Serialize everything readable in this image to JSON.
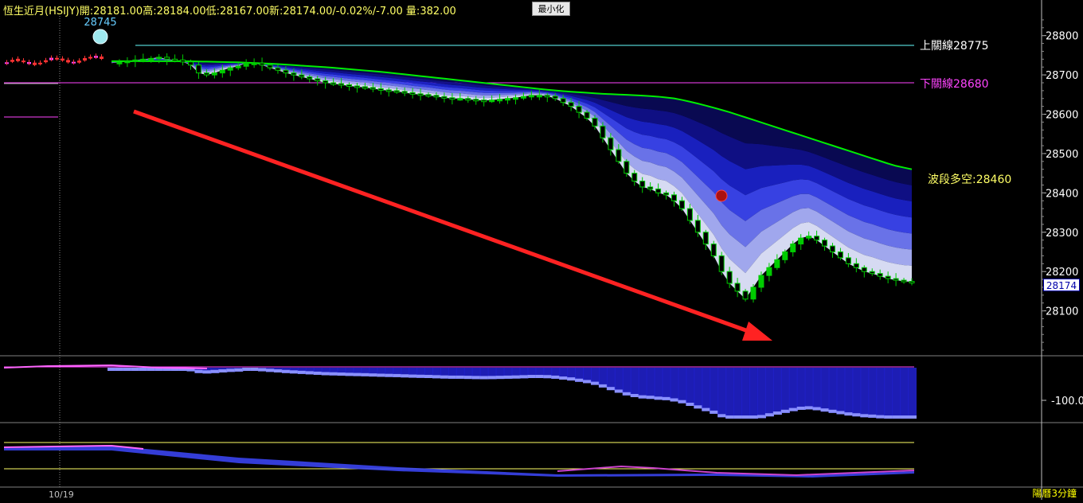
{
  "header": {
    "text": "恆生近月(HSIJY)開:28181.00高:28184.00低:28167.00新:28174.00/-0.02%/-7.00 量:382.00",
    "minimize_label": "最小化"
  },
  "labels": {
    "upper_line": "上關線28775",
    "lower_line": "下關線28680",
    "wave": "波段多空:28460",
    "peak": "28745",
    "current_price": "28174",
    "lower_axis": "-100.0",
    "date": "10/19",
    "period": "陽曆3分鐘"
  },
  "colors": {
    "background": "#000000",
    "up_candle": "#00cc00",
    "down_candle": "#ff3333",
    "upper_line": "#66ffff",
    "lower_line": "#ff44ff",
    "ma_line": "#00ee00",
    "arrow": "#ff2222",
    "axis_text": "#ffffff",
    "header_text": "#ffff66"
  },
  "chart_data": {
    "type": "candlestick",
    "ylim": [
      28000,
      28850
    ],
    "yticks": [
      28100,
      28200,
      28300,
      28400,
      28500,
      28600,
      28700,
      28800
    ],
    "upper_line": 28775,
    "lower_line": 28680,
    "wave_value": 28460,
    "peak_value": 28745,
    "last": 28174,
    "open": 28181,
    "high": 28184,
    "low": 28167,
    "change_pct": -0.02,
    "change": -7,
    "volume": 382,
    "close_path": [
      28730,
      28732,
      28735,
      28738,
      28740,
      28742,
      28745,
      28740,
      28738,
      28733,
      28725,
      28705,
      28700,
      28705,
      28712,
      28718,
      28722,
      28730,
      28730,
      28725,
      28718,
      28712,
      28705,
      28700,
      28695,
      28690,
      28685,
      28680,
      28678,
      28675,
      28672,
      28670,
      28668,
      28665,
      28662,
      28660,
      28658,
      28655,
      28652,
      28650,
      28648,
      28645,
      28642,
      28640,
      28640,
      28638,
      28636,
      28635,
      28636,
      28638,
      28640,
      28642,
      28645,
      28648,
      28648,
      28646,
      28640,
      28630,
      28620,
      28605,
      28590,
      28570,
      28540,
      28510,
      28480,
      28450,
      28430,
      28415,
      28410,
      28400,
      28395,
      28380,
      28360,
      28330,
      28300,
      28270,
      28240,
      28200,
      28170,
      28150,
      28130,
      28160,
      28190,
      28210,
      28230,
      28250,
      28270,
      28285,
      28290,
      28280,
      28265,
      28250,
      28235,
      28220,
      28210,
      28200,
      28195,
      28188,
      28182,
      28178,
      28175,
      28174
    ],
    "ma_path": [
      28735,
      28735,
      28735,
      28735,
      28735,
      28734,
      28733,
      28732,
      28730,
      28728,
      28725,
      28722,
      28719,
      28715,
      28711,
      28707,
      28702,
      28697,
      28692,
      28687,
      28682,
      28677,
      28672,
      28667,
      28662,
      28658,
      28655,
      28652,
      28650,
      28648,
      28645,
      28640,
      28630,
      28618,
      28605,
      28590,
      28575,
      28560,
      28545,
      28530,
      28515,
      28500,
      28485,
      28470,
      28460
    ]
  }
}
